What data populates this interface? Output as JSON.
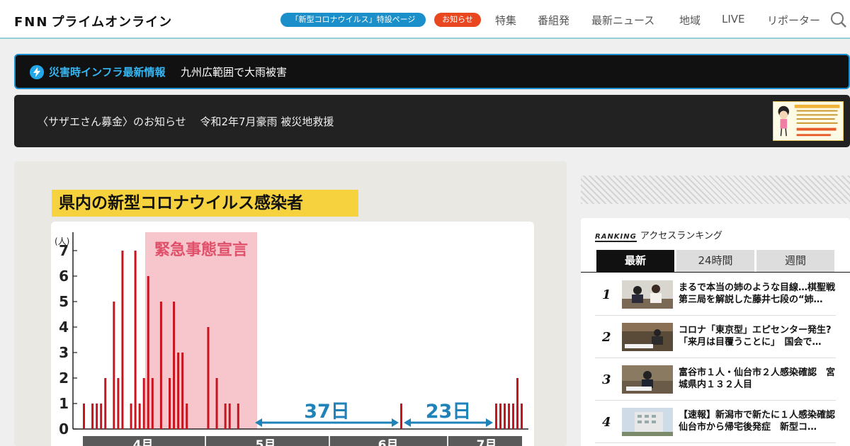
{
  "header": {
    "logo_prefix": "FNN",
    "logo_text": "プライムオンライン",
    "corona_pill": "「新型コロナウイルス」特設ページ",
    "notice_pill": "お知らせ",
    "nav": [
      "特集",
      "番組発",
      "最新ニュース",
      "地域",
      "LIVE",
      "リポーター"
    ],
    "icons": {
      "search": "search-icon"
    },
    "colors": {
      "corona_pill": "#1a8fc9",
      "notice_pill": "#e8471f"
    }
  },
  "alert": {
    "title": "災害時インフラ最新情報",
    "text": "九州広範囲で大雨被害",
    "icon": "lightning-icon",
    "accent": "#1b8fd0"
  },
  "banner": {
    "text": "〈サザエさん募金〉のお知らせ　 令和2年7月豪雨 被災地救援"
  },
  "chart_data": {
    "type": "bar",
    "title": "県内の新型コロナウイルス感染者",
    "ylabel": "(人)",
    "ylim": [
      0,
      7.5
    ],
    "yticks": [
      0,
      1,
      2,
      3,
      4,
      5,
      6,
      7
    ],
    "month_labels": [
      "4月",
      "5月",
      "6月",
      "7月"
    ],
    "emergency_label": "緊急事態宣言",
    "gap_labels": [
      "37日",
      "23日"
    ],
    "values": [
      1,
      0,
      1,
      1,
      1,
      2,
      0,
      5,
      2,
      7,
      0,
      1,
      7,
      1,
      2,
      6,
      2,
      0,
      5,
      0,
      2,
      5,
      3,
      3,
      1,
      0,
      0,
      0,
      0,
      4,
      0,
      2,
      0,
      1,
      1,
      0,
      1
    ],
    "values_late": [
      1,
      1,
      1,
      1,
      1,
      2,
      1
    ],
    "bar_color": "#c8141e",
    "emergency_color": "#f7c6cc",
    "arrow_color": "#1f82b8"
  },
  "ranking": {
    "header_prefix": "RANKING",
    "header": "アクセスランキング",
    "tabs": [
      "最新",
      "24時間",
      "週間"
    ],
    "items": [
      {
        "rank": "1",
        "title": "まるで本当の姉のような目線…棋聖戦第三局を解説した藤井七段の“姉…"
      },
      {
        "rank": "2",
        "title": "コロナ「東京型」エピセンター発生?「来月は目覆うことに」　国会で…"
      },
      {
        "rank": "3",
        "title": "富谷市１人・仙台市２人感染確認　宮城県内１３２人目"
      },
      {
        "rank": "4",
        "title": "【速報】新潟市で新たに１人感染確認　仙台市から帰宅後発症　新型コ…"
      }
    ]
  }
}
